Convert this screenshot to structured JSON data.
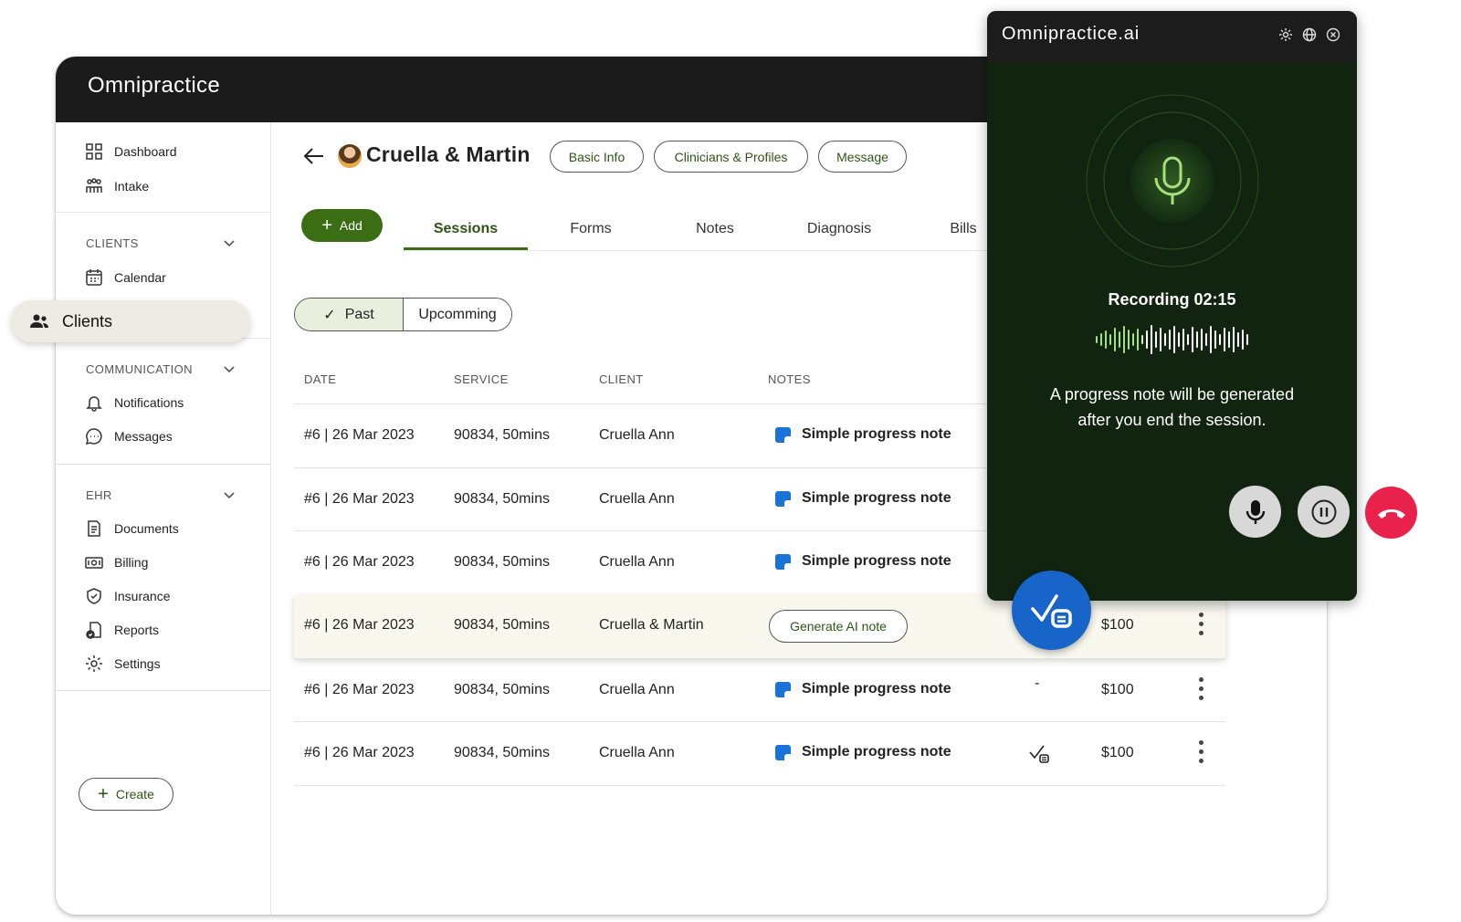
{
  "app": {
    "logo": "Omnipractice"
  },
  "sidebar": {
    "top_items": [
      {
        "label": "Dashboard",
        "icon": "grid-icon"
      },
      {
        "label": "Intake",
        "icon": "intake-icon"
      }
    ],
    "sections": [
      {
        "title": "CLIENTS",
        "items": [
          {
            "label": "Calendar",
            "icon": "calendar-icon"
          }
        ]
      },
      {
        "title": "COMMUNICATION",
        "items": [
          {
            "label": "Notifications",
            "icon": "bell-icon"
          },
          {
            "label": "Messages",
            "icon": "chat-icon"
          }
        ]
      },
      {
        "title": "EHR",
        "items": [
          {
            "label": "Documents",
            "icon": "document-icon"
          },
          {
            "label": "Billing",
            "icon": "billing-icon"
          },
          {
            "label": "Insurance",
            "icon": "shield-icon"
          },
          {
            "label": "Reports",
            "icon": "reports-icon"
          },
          {
            "label": "Settings",
            "icon": "gear-icon"
          }
        ]
      }
    ],
    "active_item": "Clients",
    "create_label": "Create"
  },
  "header": {
    "client_name": "Cruella & Martin",
    "buttons": [
      "Basic Info",
      "Clinicians & Profiles",
      "Message"
    ]
  },
  "add_label": "Add",
  "tabs": [
    "Sessions",
    "Forms",
    "Notes",
    "Diagnosis",
    "Bills"
  ],
  "active_tab": "Sessions",
  "filter": {
    "past": "Past",
    "upcoming": "Upcomming"
  },
  "table": {
    "columns": [
      "DATE",
      "SERVICE",
      "CLIENT",
      "NOTES"
    ],
    "rows": [
      {
        "date": "#6 | 26 Mar 2023",
        "service": "90834, 50mins",
        "client": "Cruella Ann",
        "note": "Simple progress note",
        "status": "",
        "amount": ""
      },
      {
        "date": "#6 | 26 Mar 2023",
        "service": "90834, 50mins",
        "client": "Cruella Ann",
        "note": "Simple progress note",
        "status": "",
        "amount": ""
      },
      {
        "date": "#6 | 26 Mar 2023",
        "service": "90834, 50mins",
        "client": "Cruella Ann",
        "note": "Simple progress note",
        "status": "",
        "amount": ""
      },
      {
        "date": "#6 | 26 Mar 2023",
        "service": "90834, 50mins",
        "client": "Cruella & Martin",
        "note": "Generate AI note",
        "status": "",
        "amount": "$100"
      },
      {
        "date": "#6 | 26 Mar 2023",
        "service": "90834, 50mins",
        "client": "Cruella Ann",
        "note": "Simple progress note",
        "status": "-",
        "amount": "$100"
      },
      {
        "date": "#6 | 26 Mar 2023",
        "service": "90834, 50mins",
        "client": "Cruella Ann",
        "note": "Simple progress note",
        "status": "check-note-icon",
        "amount": "$100"
      }
    ]
  },
  "recorder": {
    "logo": "Omnipractice.ai",
    "status": "Recording 02:15",
    "message": "A progress note will be generated after you end the session.",
    "colors": {
      "bg": "#102410",
      "mic": "#a6e07a",
      "end": "#e8224a",
      "fab": "#1765c8"
    }
  }
}
